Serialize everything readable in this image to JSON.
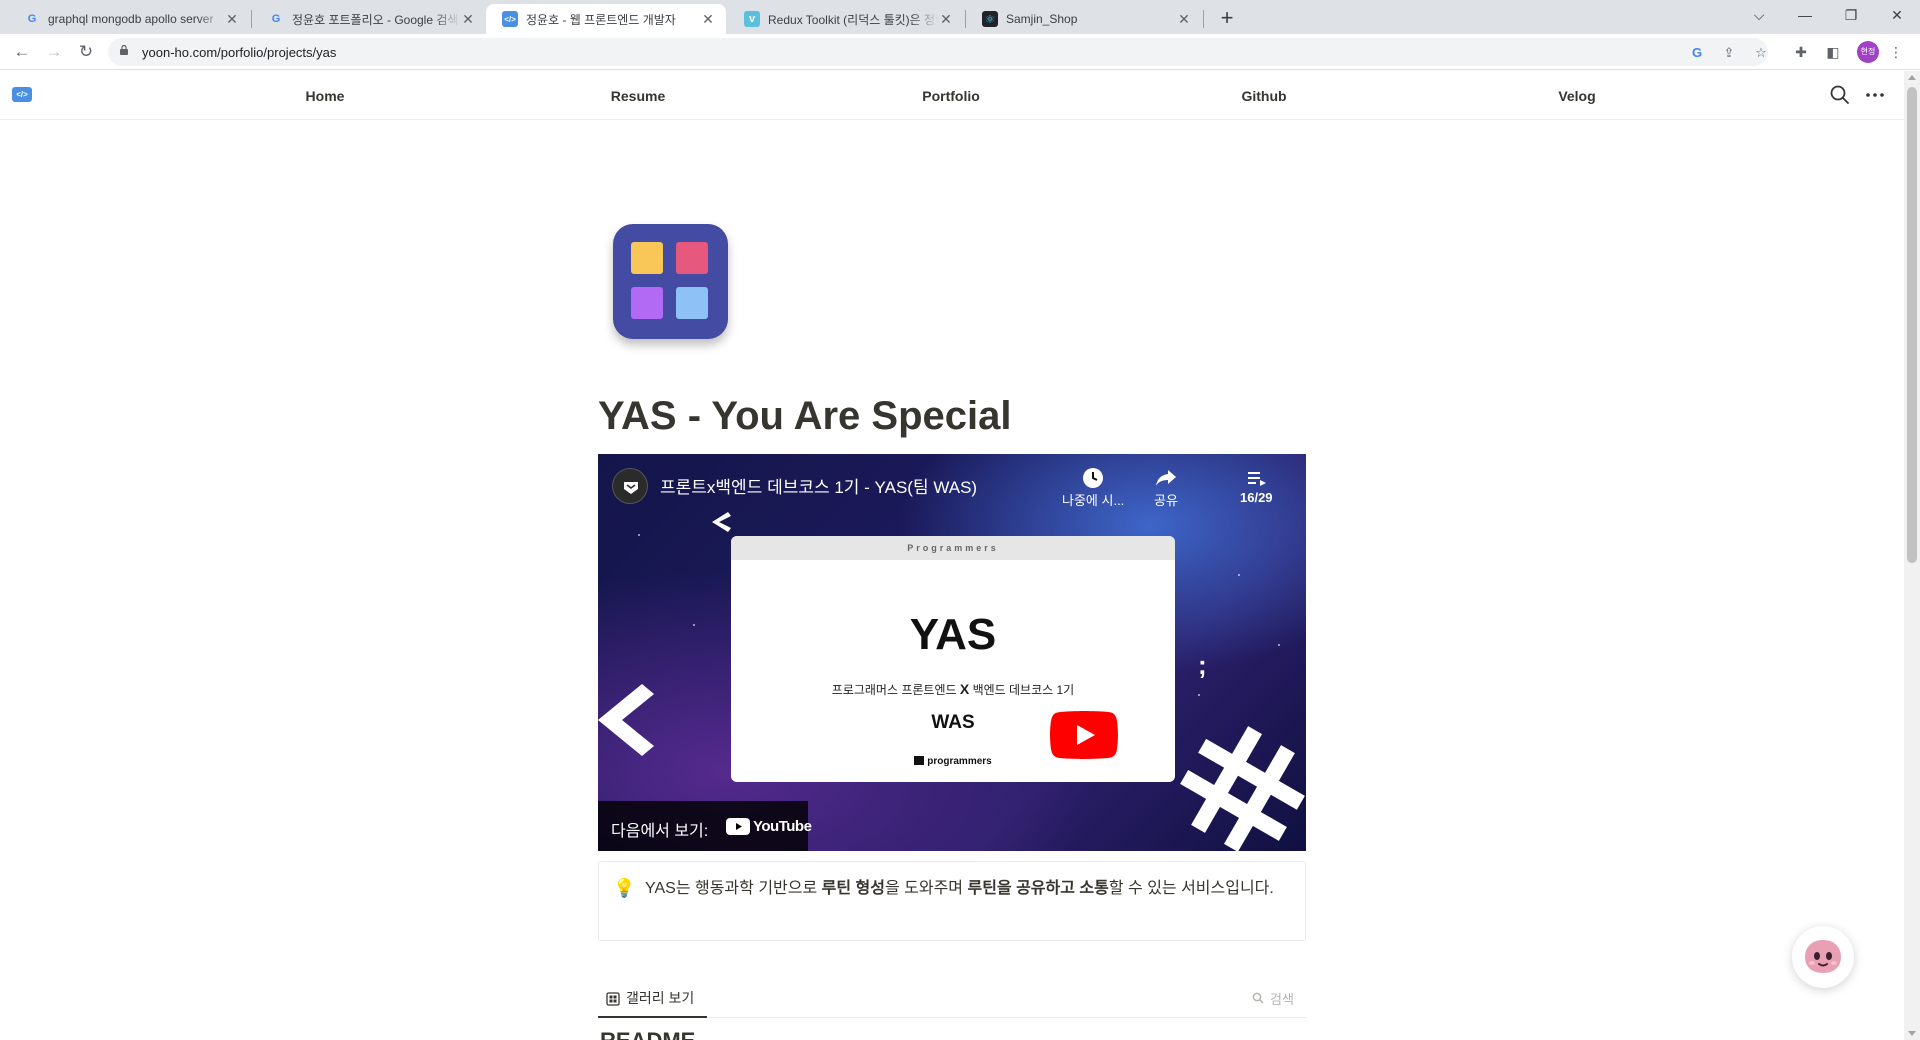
{
  "browser": {
    "tabs": [
      {
        "title": "graphql mongodb apollo server",
        "favicon": "google-icon",
        "active": false
      },
      {
        "title": "정윤호 포트폴리오 - Google 검색",
        "favicon": "google-icon",
        "active": false
      },
      {
        "title": "정윤호 - 웹 프론트엔드 개발자",
        "favicon": "code-icon",
        "active": true
      },
      {
        "title": "Redux Toolkit (리덕스 툴킷)은 정말",
        "favicon": "velog-icon",
        "active": false
      },
      {
        "title": "Samjin_Shop",
        "favicon": "react-icon",
        "active": false
      }
    ],
    "url": "yoon-ho.com/porfolio/projects/yas",
    "profile_initials": "현정"
  },
  "site_nav": {
    "links": [
      "Home",
      "Resume",
      "Portfolio",
      "Github",
      "Velog"
    ]
  },
  "page": {
    "icon": "app-grid-icon",
    "icon_colors": {
      "bg": "#434ba2",
      "yellow": "#f8c757",
      "pink": "#e6587e",
      "purple": "#b26af5",
      "blue": "#8ec2f7"
    },
    "title": "YAS - You Are Special",
    "video": {
      "title": "프론트x백엔드 데브코스 1기 - YAS(팀 WAS)",
      "watch_later": "나중에 시...",
      "share": "공유",
      "playlist": "16/29",
      "slide_header": "Programmers",
      "slide_big": "YAS",
      "slide_sub_a": "프로그래머스 프론트엔드",
      "slide_sub_x": "X",
      "slide_sub_b": "백엔드 데브코스 1기",
      "slide_team": "WAS",
      "slide_logo": "programmers",
      "watch_on": "다음에서 보기:",
      "youtube": "YouTube"
    },
    "callout": {
      "icon": "💡",
      "p1": "YAS는 행동과학 기반으로 ",
      "b1": "루틴 형성",
      "p2": "을 도와주며 ",
      "b2": "루틴을 공유하고 소통",
      "p3": "할 수 있는 서비스입니다."
    },
    "view_tab": "갤러리 보기",
    "search_placeholder": "검색",
    "next_heading": "README"
  }
}
